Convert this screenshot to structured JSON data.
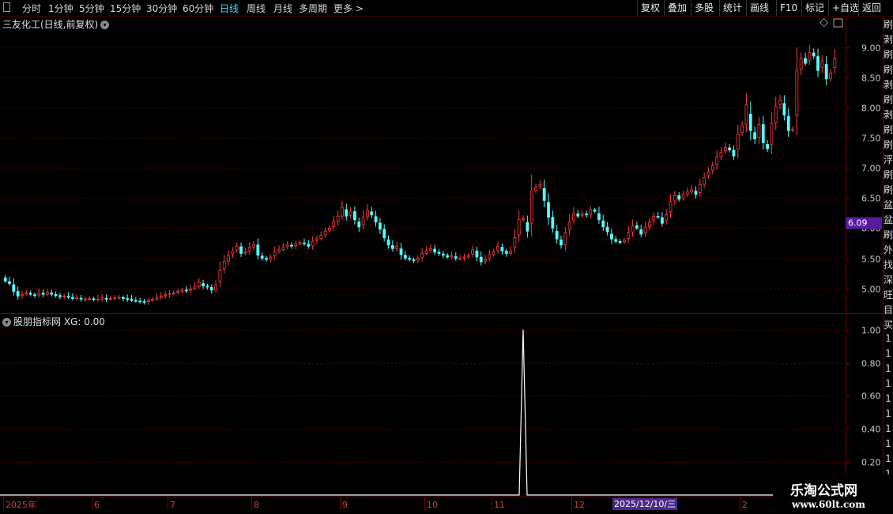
{
  "toolbar": {
    "left_items": [
      "分时",
      "1分钟",
      "5分钟",
      "15分钟",
      "30分钟",
      "60分钟",
      "日线",
      "周线",
      "月线",
      "多周期",
      "更多 >"
    ],
    "active": "日线",
    "right_items": [
      "复权",
      "叠加",
      "多股",
      "统计",
      "画线",
      "F10",
      "标记",
      "+自选",
      "返回"
    ]
  },
  "stock": {
    "title": "三友化工(日线,前复权)",
    "current_price_label": "6.09"
  },
  "indicator": {
    "title": "股朋指标网 XG: 0.00"
  },
  "side_strip": {
    "chars": [
      "刷",
      "剥",
      "刷",
      "刷",
      "剥",
      "刷",
      "剥",
      "刷",
      "刷",
      "浮",
      "刷",
      "刷",
      "盆",
      "盆",
      "刷",
      "外",
      "找",
      "深",
      "旺",
      "目",
      "买",
      "1",
      "1",
      "1",
      "1",
      "1",
      "1",
      "1",
      "1",
      "1",
      "1"
    ]
  },
  "watermark": {
    "line1": "乐淘公式网",
    "line2": "www.60lt.com"
  },
  "date_box": "2025/12/10/三",
  "colors": {
    "up": "#ff3c3c",
    "down": "#54ffff",
    "grid": "#5a0000",
    "axis_text": "#c8c8c8",
    "price_tag_bg": "#5a1aa0"
  },
  "chart_data": [
    {
      "type": "candlestick",
      "title": "三友化工(日线,前复权)",
      "ylim": [
        4.6,
        9.2
      ],
      "yticks": [
        5.0,
        5.5,
        6.0,
        6.5,
        7.0,
        7.5,
        8.0,
        8.5,
        9.0
      ],
      "last_price": 6.09,
      "x_labels": [
        "2025年",
        "6",
        "7",
        "8",
        "9",
        "10",
        "11",
        "12",
        "1",
        "2"
      ],
      "x_label_index": [
        0,
        21,
        39,
        59,
        80,
        100,
        116,
        135,
        155,
        175
      ],
      "closes": [
        5.12,
        5.08,
        4.95,
        4.87,
        4.9,
        4.92,
        4.9,
        4.88,
        4.92,
        4.9,
        4.93,
        4.9,
        4.88,
        4.86,
        4.87,
        4.85,
        4.83,
        4.84,
        4.82,
        4.82,
        4.83,
        4.81,
        4.82,
        4.84,
        4.82,
        4.83,
        4.84,
        4.85,
        4.83,
        4.82,
        4.8,
        4.79,
        4.78,
        4.77,
        4.8,
        4.82,
        4.84,
        4.87,
        4.89,
        4.91,
        4.92,
        4.95,
        4.97,
        4.96,
        4.99,
        5.03,
        5.1,
        5.04,
        5.02,
        4.97,
        5.05,
        5.3,
        5.45,
        5.55,
        5.62,
        5.7,
        5.58,
        5.6,
        5.68,
        5.72,
        5.55,
        5.5,
        5.48,
        5.52,
        5.6,
        5.64,
        5.68,
        5.72,
        5.7,
        5.74,
        5.76,
        5.74,
        5.7,
        5.78,
        5.82,
        5.88,
        5.95,
        6.0,
        6.1,
        6.2,
        6.35,
        6.2,
        6.28,
        6.14,
        6.02,
        6.18,
        6.3,
        6.22,
        6.1,
        5.98,
        5.84,
        5.72,
        5.66,
        5.7,
        5.56,
        5.5,
        5.48,
        5.46,
        5.5,
        5.58,
        5.62,
        5.66,
        5.6,
        5.58,
        5.55,
        5.52,
        5.54,
        5.5,
        5.5,
        5.52,
        5.54,
        5.64,
        5.52,
        5.44,
        5.48,
        5.56,
        5.6,
        5.7,
        5.62,
        5.58,
        5.62,
        5.84,
        6.14,
        6.16,
        5.95,
        6.62,
        6.68,
        6.72,
        6.46,
        6.18,
        6.0,
        5.82,
        5.72,
        5.92,
        6.1,
        6.24,
        6.2,
        6.24,
        6.22,
        6.3,
        6.28,
        6.14,
        6.02,
        5.94,
        5.82,
        5.78,
        5.76,
        5.8,
        5.92,
        6.04,
        6.0,
        5.9,
        6.02,
        6.1,
        6.2,
        6.18,
        6.08,
        6.22,
        6.44,
        6.54,
        6.48,
        6.56,
        6.6,
        6.64,
        6.56,
        6.72,
        6.84,
        6.94,
        7.04,
        7.18,
        7.26,
        7.34,
        7.3,
        7.2,
        7.56,
        7.7,
        8.05,
        7.62,
        7.48,
        7.72,
        7.42,
        7.32,
        7.74,
        8.02,
        8.12,
        7.88,
        7.62,
        7.64,
        8.62,
        8.82,
        8.74,
        8.92,
        8.86,
        8.62,
        8.78,
        8.48,
        8.58,
        8.82
      ]
    },
    {
      "type": "line",
      "title": "股朋指标网 XG: 0.00",
      "ylim": [
        0,
        1.07
      ],
      "yticks": [
        0.2,
        0.4,
        0.6,
        0.8,
        1.0
      ],
      "series": [
        {
          "name": "XG",
          "spike_index": 123,
          "spike_value": 1.0,
          "base_value": 0.0
        }
      ]
    }
  ]
}
